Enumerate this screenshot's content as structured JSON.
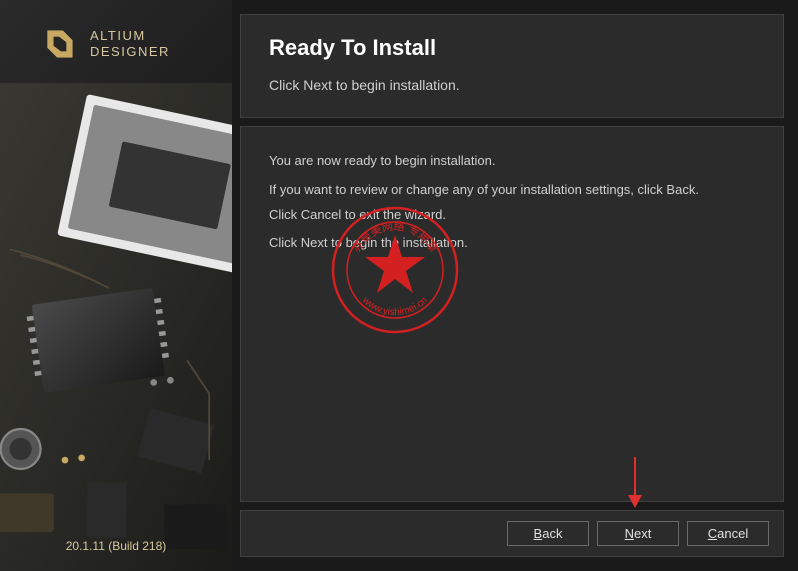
{
  "brand": {
    "line1": "ALTIUM",
    "line2": "DESIGNER"
  },
  "version": "20.1.11 (Build 218)",
  "header": {
    "title": "Ready To Install",
    "subtitle": "Click Next to begin installation."
  },
  "content": {
    "line1": "You are now ready to begin installation.",
    "line2": "If you want to review or change any of your installation settings, click Back.",
    "line3": "Click Cancel to exit the wizard.",
    "line4": "Click Next to begin the installation."
  },
  "buttons": {
    "back": "Back",
    "next": "Next",
    "cancel": "Cancel"
  },
  "stamp": {
    "text_url": "www.yishimei.cn",
    "text_top": "亦是美网络 专用章"
  }
}
